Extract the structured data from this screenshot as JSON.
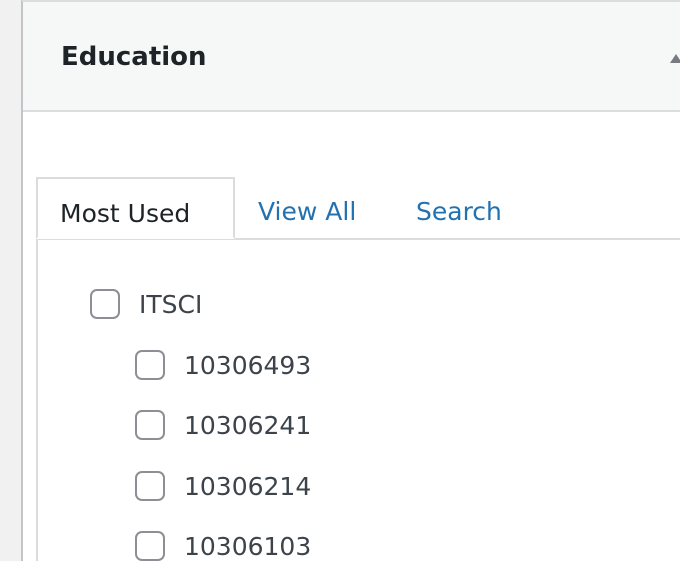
{
  "metabox": {
    "title": "Education"
  },
  "tabs": [
    {
      "label": "Most Used",
      "active": true
    },
    {
      "label": "View All",
      "active": false
    },
    {
      "label": "Search",
      "active": false
    }
  ],
  "categories": [
    {
      "label": "ITSCI",
      "checked": false,
      "level": 0
    },
    {
      "label": "10306493",
      "checked": false,
      "level": 1
    },
    {
      "label": "10306241",
      "checked": false,
      "level": 1
    },
    {
      "label": "10306214",
      "checked": false,
      "level": 1
    },
    {
      "label": "10306103",
      "checked": false,
      "level": 1
    }
  ],
  "colors": {
    "link": "#2271b1",
    "text": "#1d2327",
    "border": "#dcdcde"
  }
}
